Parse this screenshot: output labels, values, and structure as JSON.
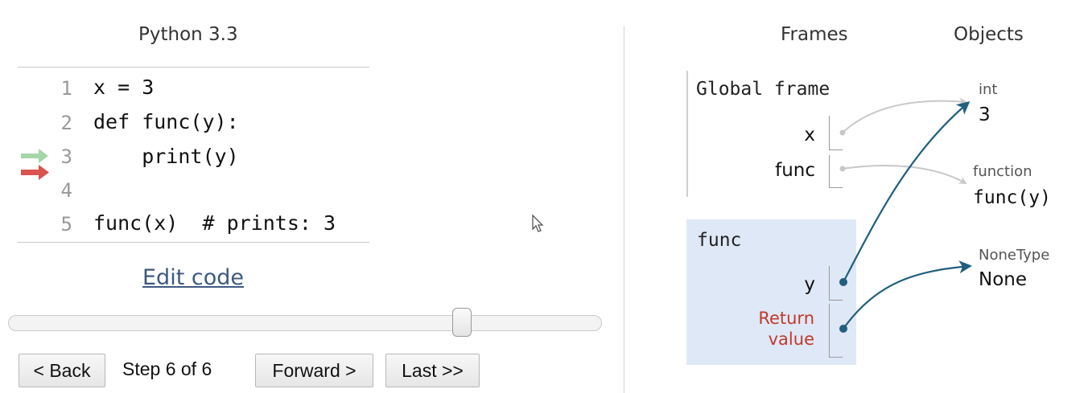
{
  "editor": {
    "language": "Python 3.3",
    "lines": [
      {
        "no": "1",
        "code": "x = 3"
      },
      {
        "no": "2",
        "code": "def func(y):"
      },
      {
        "no": "3",
        "code": "    print(y)"
      },
      {
        "no": "4",
        "code": ""
      },
      {
        "no": "5",
        "code": "func(x)  # prints: 3"
      }
    ],
    "edit_link": "Edit code",
    "colors": {
      "prev_line_arrow": "#a5d6a7",
      "next_line_arrow": "#d9534f"
    }
  },
  "navigation": {
    "back": "< Back",
    "step_label": "Step 6 of 6",
    "forward": "Forward >",
    "last": "Last >>",
    "slider_position": 0.77
  },
  "visualizer": {
    "frames_header": "Frames",
    "objects_header": "Objects",
    "global_frame": {
      "title": "Global frame",
      "vars": [
        {
          "name": "x"
        },
        {
          "name": "func"
        }
      ]
    },
    "func_frame": {
      "title": "func",
      "vars": [
        {
          "name": "y"
        }
      ],
      "return_label": [
        "Return",
        "value"
      ]
    },
    "objects": [
      {
        "type": "int",
        "value": "3"
      },
      {
        "type": "function",
        "value": "func(y)"
      },
      {
        "type": "NoneType",
        "value": "None"
      }
    ],
    "colors": {
      "active_pointer": "#1f5f7f",
      "inactive_pointer": "#c8c8c8",
      "frame_bg": "#dfe8f6",
      "return_label": "#c0392b"
    }
  }
}
